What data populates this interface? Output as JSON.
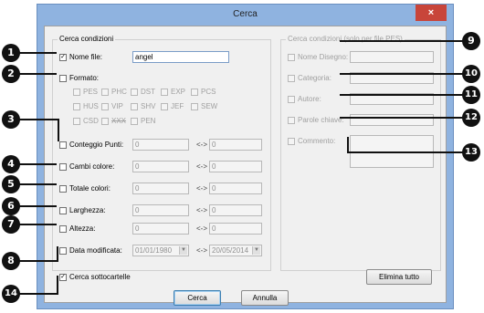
{
  "window": {
    "title": "Cerca",
    "close_glyph": "×"
  },
  "left_group": {
    "title": "Cerca condizioni",
    "name_label": "Nome file:",
    "name_value": "angel",
    "format_label": "Formato:",
    "formats": [
      "PES",
      "PHC",
      "DST",
      "EXP",
      "PCS",
      "HUS",
      "VIP",
      "SHV",
      "JEF",
      "SEW",
      "CSD",
      "XXX",
      "PEN"
    ],
    "rows": [
      {
        "label": "Conteggio Punti:",
        "from": "0",
        "sep": "<->",
        "to": "0"
      },
      {
        "label": "Cambi colore:",
        "from": "0",
        "sep": "<->",
        "to": "0"
      },
      {
        "label": "Totale colori:",
        "from": "0",
        "sep": "<->",
        "to": "0"
      },
      {
        "label": "Larghezza:",
        "from": "0",
        "sep": "<->",
        "to": "0"
      },
      {
        "label": "Altezza:",
        "from": "0",
        "sep": "<->",
        "to": "0"
      }
    ],
    "date_label": "Data modificata:",
    "date_from": "01/01/1980",
    "date_sep": "<->",
    "date_to": "20/05/2014"
  },
  "right_group": {
    "title": "Cerca condizioni (solo per file PES)",
    "fields": [
      "Nome Disegno:",
      "Categoria:",
      "Autore:",
      "Parole chiave:",
      "Commento:"
    ]
  },
  "subfolders_label": "Cerca sottocartelle",
  "buttons": {
    "clear_all": "Elimina tutto",
    "search": "Cerca",
    "cancel": "Annulla"
  },
  "markers": [
    "1",
    "2",
    "3",
    "4",
    "5",
    "6",
    "7",
    "8",
    "9",
    "10",
    "11",
    "12",
    "13",
    "14"
  ],
  "colors": {
    "marker_bg": "#111111",
    "title_bar": "#8fb3e0",
    "close_button": "#c8453a"
  }
}
